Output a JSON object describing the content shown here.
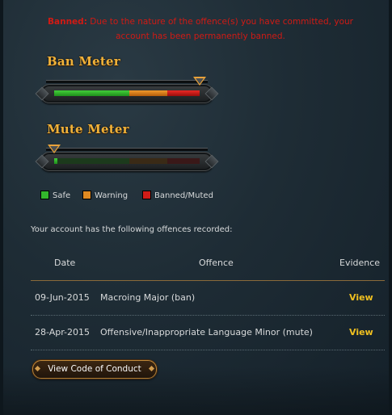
{
  "banned": {
    "label": "Banned:",
    "message": "Due to the nature of the offence(s) you have committed, your account has been permanently banned."
  },
  "ban_meter": {
    "title": "Ban Meter",
    "level": 1.0,
    "segments": [
      "safe",
      "warning",
      "banned"
    ]
  },
  "mute_meter": {
    "title": "Mute Meter",
    "level": 0.0,
    "segments": [
      "safe",
      "warning",
      "banned"
    ]
  },
  "legend": {
    "safe": "Safe",
    "warning": "Warning",
    "banned_muted": "Banned/Muted"
  },
  "colors": {
    "safe": "#33b52c",
    "warning": "#e08a22",
    "banned": "#d01c18",
    "link": "#f0c020",
    "title_gold": "#f0b23a",
    "alert_red": "#d11a14"
  },
  "offences": {
    "intro": "Your account has the following offences recorded:",
    "headers": {
      "date": "Date",
      "offence": "Offence",
      "evidence": "Evidence"
    },
    "rows": [
      {
        "date": "09-Jun-2015",
        "offence": "Macroing Major (ban)",
        "evidence": "View"
      },
      {
        "date": "28-Apr-2015",
        "offence": "Offensive/Inappropriate Language Minor (mute)",
        "evidence": "View"
      }
    ]
  },
  "buttons": {
    "code_of_conduct": "View Code of Conduct"
  }
}
